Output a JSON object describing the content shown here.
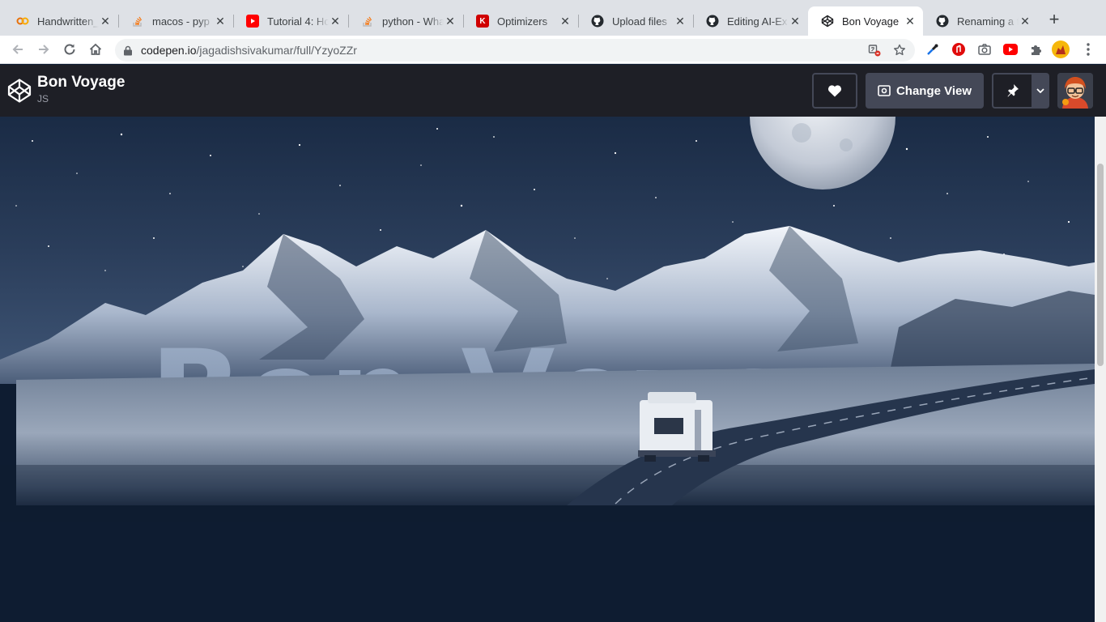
{
  "browser": {
    "tabs": [
      {
        "title": "Handwritten_",
        "icon": "colab-icon"
      },
      {
        "title": "macos - pyp",
        "icon": "stackoverflow-icon"
      },
      {
        "title": "Tutorial 4: Ho",
        "icon": "youtube-icon"
      },
      {
        "title": "python - Wha",
        "icon": "stackoverflow-icon"
      },
      {
        "title": "Optimizers",
        "icon": "keras-icon"
      },
      {
        "title": "Upload files",
        "icon": "github-icon"
      },
      {
        "title": "Editing AI-Ex",
        "icon": "github-icon"
      },
      {
        "title": "Bon Voyage",
        "icon": "codepen-icon",
        "active": true
      },
      {
        "title": "Renaming a f",
        "icon": "github-icon"
      }
    ],
    "url_host": "codepen.io",
    "url_path": "/jagadishsivakumar/full/YzyoZZr"
  },
  "pen": {
    "title": "Bon Voyage",
    "subtitle": "JS",
    "change_view_label": "Change View"
  },
  "hero": {
    "headline": "Bon Voyage"
  },
  "colors": {
    "header_bg": "#1e1f26",
    "button_bg": "#444857",
    "page_bg": "#0e1c31"
  }
}
